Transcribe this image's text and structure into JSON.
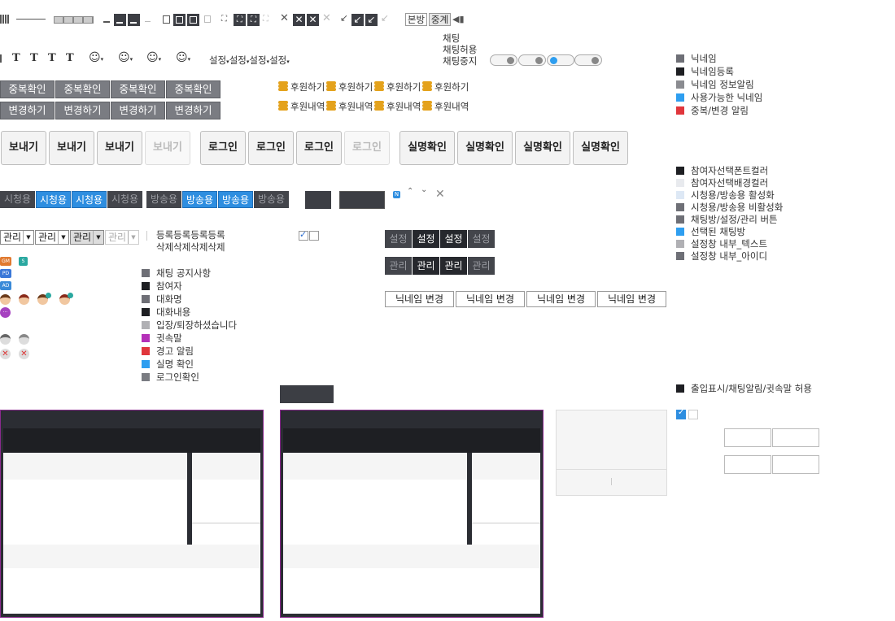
{
  "toolbar": {
    "tab_main": "본방",
    "tab_relay": "중계"
  },
  "chat_status": {
    "chat": "채팅",
    "chat_allowed": "채팅허용",
    "chat_stopped": "채팅중지"
  },
  "font_buttons": [
    "T",
    "T",
    "T",
    "T"
  ],
  "settings_menu": [
    "설정",
    "설정",
    "설정",
    "설정"
  ],
  "dup_buttons": [
    "중복확인",
    "중복확인",
    "중복확인",
    "중복확인"
  ],
  "change_buttons": [
    "변경하기",
    "변경하기",
    "변경하기",
    "변경하기"
  ],
  "donate_links": [
    "후원하기",
    "후원하기",
    "후원하기",
    "후원하기"
  ],
  "donate_history": [
    "후원내역",
    "후원내역",
    "후원내역",
    "후원내역"
  ],
  "send_buttons": [
    "보내기",
    "보내기",
    "보내기",
    "보내기"
  ],
  "login_buttons": [
    "로그인",
    "로그인",
    "로그인",
    "로그인"
  ],
  "verify_buttons": [
    "실명확인",
    "실명확인",
    "실명확인",
    "실명확인"
  ],
  "viewer_tabs": [
    "시청용",
    "시청용",
    "시청용",
    "시청용"
  ],
  "broadcast_tabs": [
    "방송용",
    "방송용",
    "방송용",
    "방송용"
  ],
  "manage_selects": [
    "관리",
    "관리",
    "관리",
    "관리"
  ],
  "register_text": "등록등록등록등록",
  "delete_text": "삭제삭제삭제삭제",
  "setting_boxes": [
    "설정",
    "설정",
    "설정",
    "설정"
  ],
  "manage_boxes": [
    "관리",
    "관리",
    "관리",
    "관리"
  ],
  "nickname_change": [
    "닉네임 변경",
    "닉네임 변경",
    "닉네임 변경",
    "닉네임 변경"
  ],
  "badges": {
    "gm": "GM",
    "s": "S",
    "pd": "PD",
    "ad": "AD"
  },
  "new_badge": "N",
  "chat_legend": [
    {
      "label": "채팅 공지사항",
      "color": "#6e6f76"
    },
    {
      "label": "참여자",
      "color": "#1e1f23"
    },
    {
      "label": "대화명",
      "color": "#6e6f76"
    },
    {
      "label": "대화내용",
      "color": "#1e1f23"
    },
    {
      "label": "입장/퇴장하셨습니다",
      "color": "#b0b0b4"
    },
    {
      "label": "귓속말",
      "color": "#b430b8"
    },
    {
      "label": "경고 알림",
      "color": "#e0363c"
    },
    {
      "label": "실명 확인",
      "color": "#2e9ef0"
    },
    {
      "label": "로그인확인",
      "color": "#7a7c82"
    }
  ],
  "nick_legend": [
    {
      "label": "닉네임",
      "color": "#6e6f76"
    },
    {
      "label": "닉네임등록",
      "color": "#1e1f23"
    },
    {
      "label": "닉네임 정보알림",
      "color": "#8a8b90"
    },
    {
      "label": "사용가능한 닉네임",
      "color": "#2e9ef0"
    },
    {
      "label": "중복/변경 알림",
      "color": "#e0363c"
    }
  ],
  "participant_legend": [
    {
      "label": "참여자선택폰트컬러",
      "color": "#1e1f23"
    },
    {
      "label": "참여자선택배경컬러",
      "color": "#e8eaee"
    },
    {
      "label": "시청용/방송용 활성화",
      "color": "#dde8f5"
    },
    {
      "label": "시청용/방송용 비활성화",
      "color": "#6e6f76"
    },
    {
      "label": "채팅방/설정/관리 버튼",
      "color": "#6e6f76"
    },
    {
      "label": "선택된 채팅방",
      "color": "#2e9ef0"
    },
    {
      "label": "설정창 내부_텍스트",
      "color": "#b0b0b4"
    },
    {
      "label": "설정창 내부_아이디",
      "color": "#6e6f76"
    }
  ],
  "entry_notice": "출입표시/채팅알림/귓속말 허용"
}
